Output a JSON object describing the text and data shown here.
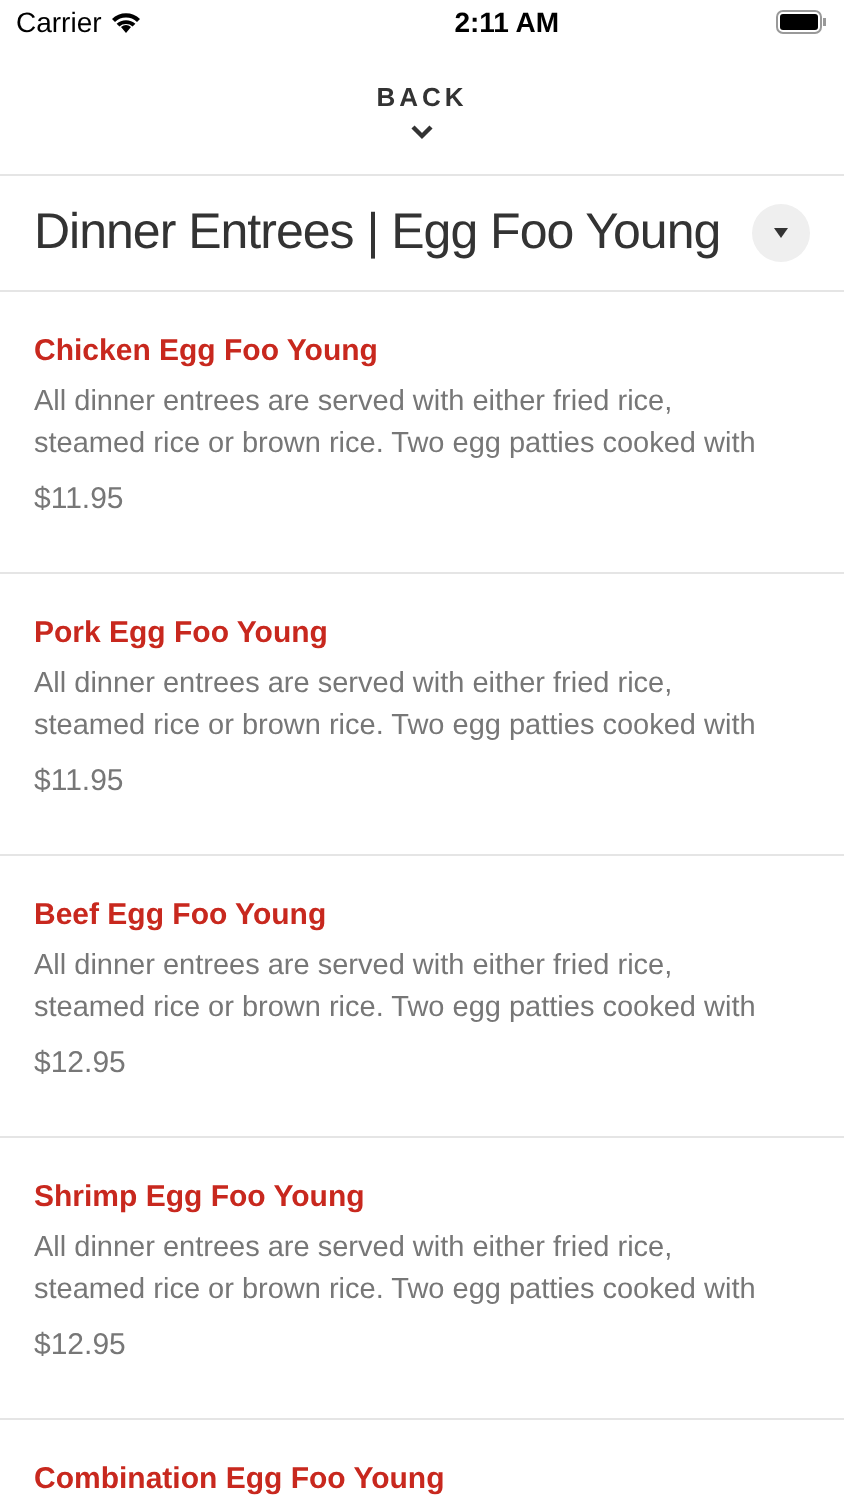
{
  "status_bar": {
    "carrier": "Carrier",
    "time": "2:11 AM"
  },
  "back": {
    "label": "BACK"
  },
  "header": {
    "title": "Dinner Entrees | Egg Foo Young"
  },
  "items": [
    {
      "name": "Chicken Egg Foo Young",
      "description_lines": [
        "All dinner entrees are served with either fried rice,",
        "steamed rice or brown rice. Two egg patties cooked with"
      ],
      "price": "$11.95"
    },
    {
      "name": "Pork Egg Foo Young",
      "description_lines": [
        "All dinner entrees are served with either fried rice,",
        "steamed rice or brown rice. Two egg patties cooked with"
      ],
      "price": "$11.95"
    },
    {
      "name": "Beef Egg Foo Young",
      "description_lines": [
        "All dinner entrees are served with either fried rice,",
        "steamed rice or brown rice. Two egg patties cooked with"
      ],
      "price": "$12.95"
    },
    {
      "name": "Shrimp Egg Foo Young",
      "description_lines": [
        "All dinner entrees are served with either fried rice,",
        "steamed rice or brown rice. Two egg patties cooked with"
      ],
      "price": "$12.95"
    },
    {
      "name": "Combination Egg Foo Young"
    }
  ]
}
